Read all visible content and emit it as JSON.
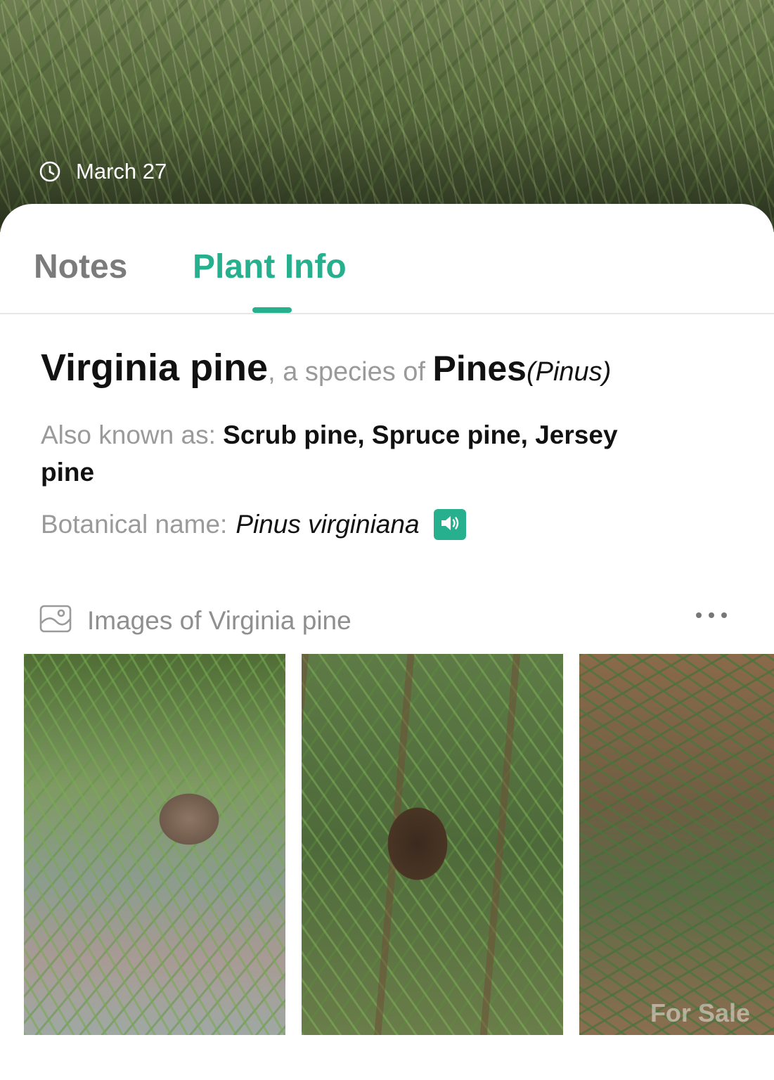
{
  "hero": {
    "date": "March 27",
    "icons": {
      "clock": "clock-icon"
    }
  },
  "tabs": [
    {
      "label": "Notes",
      "active": false
    },
    {
      "label": "Plant Info",
      "active": true
    }
  ],
  "plant": {
    "common_name": "Virginia pine",
    "separator": ", a species of ",
    "genus": "Pines",
    "genus_latin": "(Pinus)",
    "aka_label": "Also known as: ",
    "aka_names": "Scrub pine, Spruce pine, Jersey pine",
    "botanical_label": "Botanical name:",
    "botanical_name": "Pinus virginiana",
    "icons": {
      "pronounce": "speaker-icon"
    }
  },
  "images": {
    "title": "Images of Virginia pine",
    "icons": {
      "header": "image-gallery-icon",
      "more": "more-horizontal-icon"
    },
    "thumbnails": [
      {
        "subject": "pine-branch-with-cone"
      },
      {
        "subject": "dark-pine-cone-on-branch"
      },
      {
        "subject": "pine-needles-on-leaf-litter",
        "watermark": "For Sale"
      }
    ]
  },
  "colors": {
    "accent": "#27b08d",
    "tab_inactive": "#7b7b7b",
    "label_gray": "#9a9a9a",
    "text_dark": "#111111"
  }
}
